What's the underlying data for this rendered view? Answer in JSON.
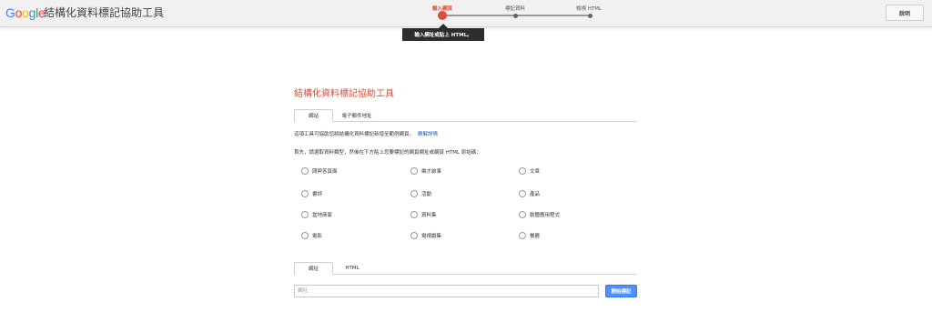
{
  "header": {
    "logo_letters": [
      {
        "char": "G",
        "color": "#4285f4"
      },
      {
        "char": "o",
        "color": "#ea4335"
      },
      {
        "char": "o",
        "color": "#fbbc05"
      },
      {
        "char": "g",
        "color": "#4285f4"
      },
      {
        "char": "l",
        "color": "#34a853"
      },
      {
        "char": "e",
        "color": "#ea4335"
      }
    ],
    "app_title": "結構化資料標記協助工具",
    "help_label": "說明"
  },
  "steps": {
    "items": [
      {
        "label": "輸入網頁",
        "active": true
      },
      {
        "label": "標記資料",
        "active": false
      },
      {
        "label": "檢視 HTML",
        "active": false
      }
    ],
    "tooltip": "輸入網址或貼上 HTML。"
  },
  "main": {
    "title": "結構化資料標記協助工具",
    "source_tabs": [
      {
        "label": "網站",
        "active": true
      },
      {
        "label": "電子郵件地址",
        "active": false
      }
    ],
    "description": "這項工具可協助您將結構化資料標記新增至範例網頁。",
    "learn_more": "瞭解詳情",
    "instruction": "首先，請選取資料類型，然後在下方貼上您要標記的網頁網址或網頁 HTML 原始碼：",
    "data_types": [
      "問與答頁面",
      "徵才啟事",
      "文章",
      "書評",
      "活動",
      "產品",
      "當地商家",
      "資料集",
      "軟體應用程式",
      "電影",
      "電視劇集",
      "餐廳"
    ],
    "input_tabs": [
      {
        "label": "網址",
        "active": true
      },
      {
        "label": "HTML",
        "active": false
      }
    ],
    "url_placeholder": "網址",
    "start_button": "開始標記"
  },
  "colors": {
    "accent_red": "#dd4b39",
    "primary_blue": "#4d90fe",
    "link_blue": "#1a53b0"
  }
}
